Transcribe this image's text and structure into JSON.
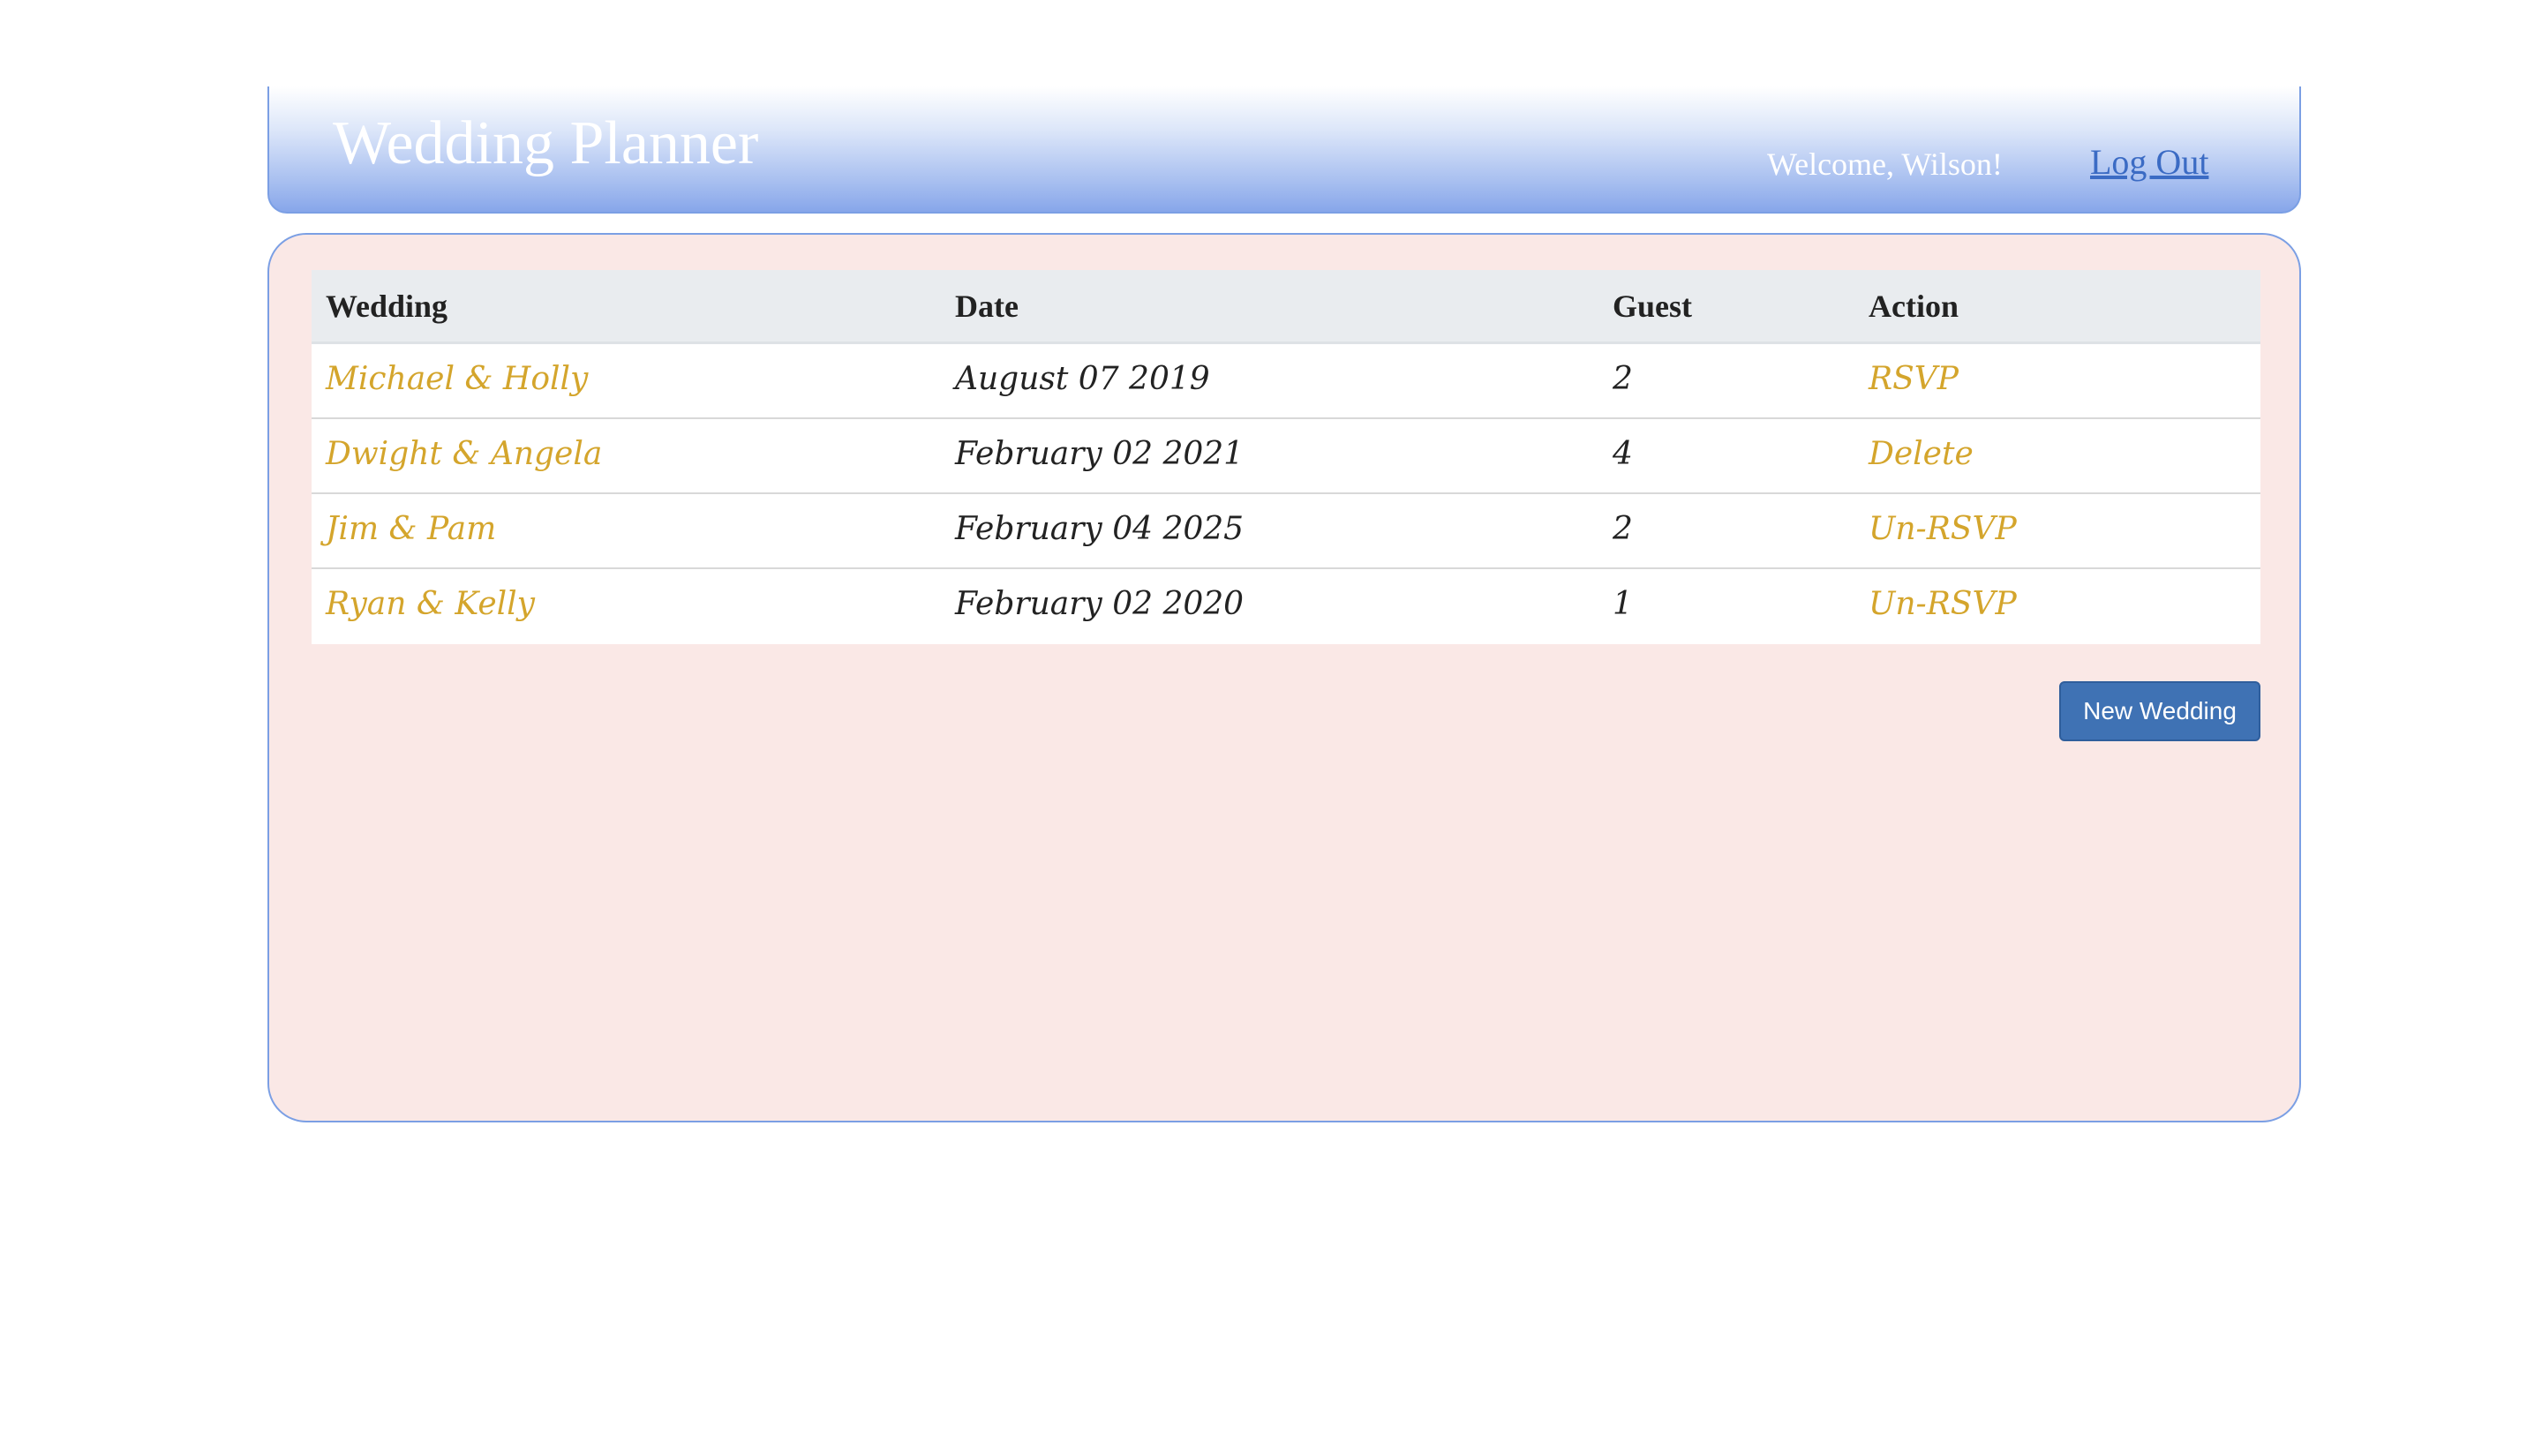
{
  "header": {
    "title": "Wedding Planner",
    "welcome": "Welcome, Wilson!",
    "logout_label": "Log Out"
  },
  "table": {
    "columns": [
      "Wedding",
      "Date",
      "Guest",
      "Action"
    ],
    "rows": [
      {
        "wedding": "Michael & Holly",
        "date": "August 07 2019",
        "guests": "2",
        "action": "RSVP"
      },
      {
        "wedding": "Dwight & Angela",
        "date": "February 02 2021",
        "guests": "4",
        "action": "Delete"
      },
      {
        "wedding": "Jim & Pam",
        "date": "February 04 2025",
        "guests": "2",
        "action": "Un-RSVP"
      },
      {
        "wedding": "Ryan & Kelly",
        "date": "February 02 2020",
        "guests": "1",
        "action": "Un-RSVP"
      }
    ]
  },
  "new_wedding_label": "New Wedding",
  "colors": {
    "header_gradient_end": "#87a6ea",
    "border": "#7b9fe4",
    "panel_bg": "#fae8e6",
    "link": "#d4a52c",
    "logout_link": "#3b6bc4",
    "button": "#3f72b4"
  }
}
